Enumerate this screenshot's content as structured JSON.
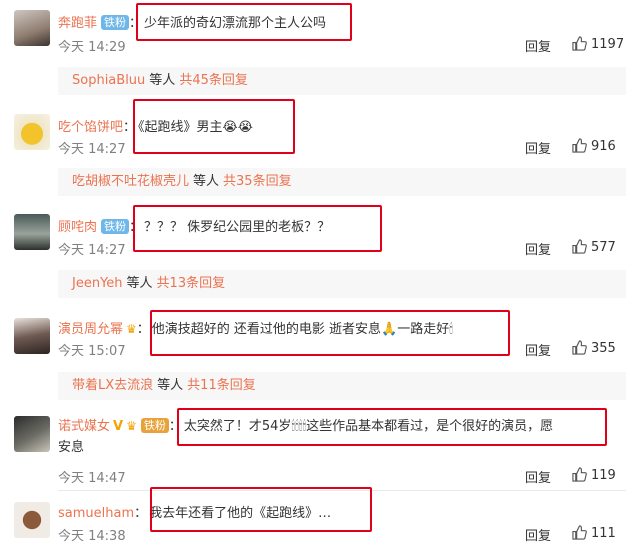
{
  "comments": [
    {
      "user": "奔跑菲",
      "badge": "铁粉",
      "text": "少年派的奇幻漂流那个主人公吗",
      "time": "今天 14:29",
      "reply": "回复",
      "likes": "1197"
    },
    {
      "user": "吃个馅饼吧",
      "text": "《起跑线》男主😭😭",
      "time": "今天 14:27",
      "reply": "回复",
      "likes": "916"
    },
    {
      "user": "顾咤肉",
      "badge": "铁粉",
      "text": "？？？ 侏罗纪公园里的老板？？",
      "time": "今天 14:27",
      "reply": "回复",
      "likes": "577"
    },
    {
      "user": "演员周允幂",
      "text": "他演技超好的 还看过他的电影 逝者安息🙏一路走好🕯",
      "time": "今天 15:07",
      "reply": "回复",
      "likes": "355"
    },
    {
      "user": "诺式媒女",
      "badge": "铁粉",
      "text_line1": "太突然了！才54岁🕯🕯🕯🕯这些作品基本都看过，是个很好的演员，愿",
      "text_line2": "安息",
      "time": "今天 14:47",
      "reply": "回复",
      "likes": "119"
    },
    {
      "user": "samuelham",
      "text": "我去年还看了他的《起跑线》…",
      "time": "今天 14:38",
      "reply": "回复",
      "likes": "111"
    }
  ],
  "threads": [
    {
      "name": "SophiaBluu",
      "mid": "等人",
      "count": "共45条回复"
    },
    {
      "name": "吃胡椒不吐花椒壳儿",
      "mid": "等人",
      "count": "共35条回复"
    },
    {
      "name": "JeenYeh",
      "mid": "等人",
      "count": "共13条回复"
    },
    {
      "name": "带着LX去流浪",
      "mid": "等人",
      "count": "共11条回复"
    }
  ],
  "colors": {
    "accent": "#eb7350",
    "highlight": "#e0001a",
    "badge": "#6fb7e8"
  }
}
